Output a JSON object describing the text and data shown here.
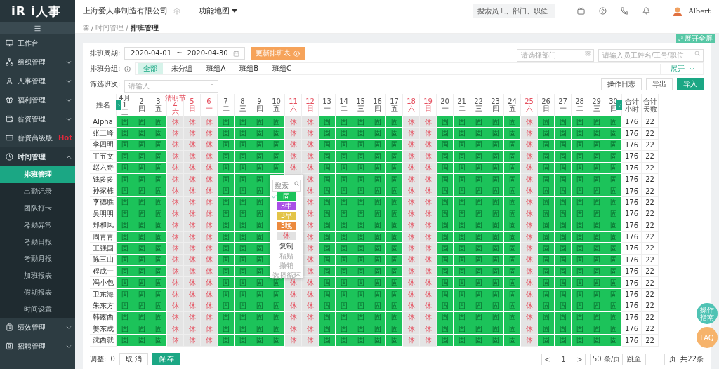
{
  "logo": "iR i人事",
  "sidebar": {
    "items": [
      {
        "label": "工作台"
      },
      {
        "label": "组织管理",
        "expanded": false
      },
      {
        "label": "人事管理",
        "expanded": false
      },
      {
        "label": "福利管理",
        "expanded": false
      },
      {
        "label": "薪资管理",
        "expanded": false
      },
      {
        "label": "薪资高级版",
        "badge": "Hot"
      },
      {
        "label": "时间管理",
        "expanded": true,
        "children": [
          {
            "label": "排班管理",
            "selected": true
          },
          {
            "label": "出勤记录",
            "selected": false
          },
          {
            "label": "团队打卡",
            "selected": false
          },
          {
            "label": "考勤异常",
            "selected": false
          },
          {
            "label": "考勤日报",
            "selected": false
          },
          {
            "label": "考勤月报",
            "selected": false
          },
          {
            "label": "加班报表",
            "selected": false
          },
          {
            "label": "假期报表",
            "selected": false
          },
          {
            "label": "时间设置",
            "selected": false
          }
        ]
      },
      {
        "label": "绩效管理",
        "expanded": false
      },
      {
        "label": "招聘管理",
        "expanded": false
      }
    ]
  },
  "topbar": {
    "company": "上海爱人事制造有限公司",
    "function_map": "功能地图",
    "search": {
      "placeholder": "搜索员工、部门、职位"
    },
    "user": "Albert"
  },
  "breadcrumb": [
    {
      "separator": "/",
      "label": "时间管理"
    },
    {
      "separator": "/",
      "label": "排班管理"
    }
  ],
  "fullscreen_button": "展开全屏",
  "filters": {
    "period_label": "排班周期:",
    "start_date": "2020-04-01",
    "separator": "~",
    "end_date": "2020-04-30",
    "update_button": "更新排班表",
    "department": {
      "placeholder": "请选择部门"
    },
    "employee_search": {
      "placeholder": "请输入员工姓名/工号/职位"
    },
    "group_label": "排班分组:",
    "groups": [
      {
        "label": "全部",
        "selected": true
      },
      {
        "label": "未分组",
        "selected": false
      },
      {
        "label": "班组A",
        "selected": false
      },
      {
        "label": "班组B",
        "selected": false
      },
      {
        "label": "班组C",
        "selected": false
      }
    ],
    "expand": "展开",
    "shift_label": "筛选班次:",
    "shift_select": {
      "placeholder": "请输入"
    },
    "buttons": [
      "操作日志",
      "导出",
      "导入"
    ]
  },
  "table": {
    "name_header": "姓名",
    "hours_header": "合计小时",
    "days_header": "合计天数",
    "days": [
      {
        "month": "4月",
        "date": "1",
        "weekday": "三",
        "rest": false
      },
      {
        "date": "2",
        "weekday": "四",
        "rest": false
      },
      {
        "date": "3",
        "weekday": "五",
        "rest": false
      },
      {
        "holiday": "清明节",
        "date": "4",
        "weekday": "六",
        "rest": true
      },
      {
        "date": "5",
        "weekday": "日",
        "rest": true
      },
      {
        "date": "6",
        "weekday": "一",
        "rest": true
      },
      {
        "date": "7",
        "weekday": "二",
        "rest": false
      },
      {
        "date": "8",
        "weekday": "三",
        "rest": false
      },
      {
        "date": "9",
        "weekday": "四",
        "rest": false
      },
      {
        "date": "10",
        "weekday": "五",
        "rest": false
      },
      {
        "date": "11",
        "weekday": "六",
        "rest": true
      },
      {
        "date": "12",
        "weekday": "日",
        "rest": true
      },
      {
        "date": "13",
        "weekday": "一",
        "rest": false
      },
      {
        "date": "14",
        "weekday": "二",
        "rest": false
      },
      {
        "date": "15",
        "weekday": "三",
        "rest": false
      },
      {
        "date": "16",
        "weekday": "四",
        "rest": false
      },
      {
        "date": "17",
        "weekday": "五",
        "rest": false
      },
      {
        "date": "18",
        "weekday": "六",
        "rest": true
      },
      {
        "date": "19",
        "weekday": "日",
        "rest": true
      },
      {
        "date": "20",
        "weekday": "一",
        "rest": false
      },
      {
        "date": "21",
        "weekday": "二",
        "rest": false
      },
      {
        "date": "22",
        "weekday": "三",
        "rest": false
      },
      {
        "date": "23",
        "weekday": "四",
        "rest": false
      },
      {
        "date": "24",
        "weekday": "五",
        "rest": false
      },
      {
        "date": "25",
        "weekday": "六",
        "rest": true
      },
      {
        "date": "26",
        "weekday": "日",
        "rest": false
      },
      {
        "date": "27",
        "weekday": "一",
        "rest": false
      },
      {
        "date": "28",
        "weekday": "二",
        "rest": false
      },
      {
        "date": "29",
        "weekday": "三",
        "rest": false
      },
      {
        "date": "30",
        "weekday": "四",
        "rest": false
      }
    ],
    "rows": [
      {
        "name": "Alpha",
        "shifts": [
          "固",
          "固",
          "固",
          "休",
          "休",
          "休",
          "固",
          "固",
          "固",
          "固",
          "休",
          "休",
          "固",
          "固",
          "固",
          "固",
          "固",
          "休",
          "休",
          "固",
          "固",
          "固",
          "固",
          "固",
          "休",
          "固",
          "固",
          "固",
          "固",
          "固"
        ],
        "hours": "176",
        "days": "22"
      },
      {
        "name": "张三峰",
        "shifts": [
          "固",
          "固",
          "固",
          "休",
          "休",
          "休",
          "固",
          "固",
          "固",
          "固",
          "休",
          "休",
          "固",
          "固",
          "固",
          "固",
          "固",
          "休",
          "休",
          "固",
          "固",
          "固",
          "固",
          "固",
          "休",
          "固",
          "固",
          "固",
          "固",
          "固"
        ],
        "hours": "176",
        "days": "22"
      },
      {
        "name": "李四明",
        "shifts": [
          "固",
          "固",
          "固",
          "休",
          "休",
          "休",
          "固",
          "固",
          "固",
          "固",
          "休",
          "休",
          "固",
          "固",
          "固",
          "固",
          "固",
          "休",
          "休",
          "固",
          "固",
          "固",
          "固",
          "固",
          "休",
          "固",
          "固",
          "固",
          "固",
          "固"
        ],
        "hours": "176",
        "days": "22"
      },
      {
        "name": "王五文",
        "shifts": [
          "固",
          "固",
          "固",
          "休",
          "休",
          "休",
          "固",
          "固",
          "固",
          "固",
          "休",
          "休",
          "固",
          "固",
          "固",
          "固",
          "固",
          "休",
          "休",
          "固",
          "固",
          "固",
          "固",
          "固",
          "休",
          "固",
          "固",
          "固",
          "固",
          "固"
        ],
        "hours": "176",
        "days": "22"
      },
      {
        "name": "赵六奇",
        "shifts": [
          "固",
          "固",
          "固",
          "休",
          "休",
          "休",
          "固",
          "固",
          "固",
          "固",
          "休",
          "休",
          "固",
          "固",
          "固",
          "固",
          "固",
          "休",
          "休",
          "固",
          "固",
          "固",
          "固",
          "固",
          "休",
          "固",
          "固",
          "固",
          "固",
          "固"
        ],
        "hours": "176",
        "days": "22"
      },
      {
        "name": "钱多多",
        "shifts_before_menu": [
          "固",
          "固",
          "固",
          "休",
          "休",
          "休",
          "固",
          "固",
          "固"
        ],
        "shifts_after_menu": [
          "休",
          "固",
          "固",
          "固",
          "固",
          "固",
          "休",
          "休",
          "固",
          "固",
          "固",
          "固",
          "固",
          "休",
          "固",
          "固",
          "固",
          "固",
          "固"
        ],
        "hours": "176",
        "days": "22"
      },
      {
        "name": "孙家栋",
        "shifts_before_menu": [
          "固",
          "固",
          "固",
          "休",
          "休",
          "休",
          "固",
          "固",
          "固"
        ],
        "shifts_after_menu": [
          "休",
          "固",
          "固",
          "固",
          "固",
          "固",
          "休",
          "休",
          "固",
          "固",
          "固",
          "固",
          "固",
          "休",
          "固",
          "固",
          "固",
          "固",
          "固"
        ],
        "hours": "176",
        "days": "22"
      },
      {
        "name": "李德胜",
        "shifts_before_menu": [
          "固",
          "固",
          "固",
          "休",
          "休",
          "休",
          "固",
          "固",
          "固"
        ],
        "shifts_after_menu": [
          "休",
          "固",
          "固",
          "固",
          "固",
          "固",
          "休",
          "休",
          "固",
          "固",
          "固",
          "固",
          "固",
          "休",
          "固",
          "固",
          "固",
          "固",
          "固"
        ],
        "hours": "176",
        "days": "22"
      },
      {
        "name": "吴明明",
        "shifts_before_menu": [
          "固",
          "固",
          "固",
          "休",
          "休",
          "休",
          "固",
          "固",
          "固"
        ],
        "shifts_after_menu": [
          "休",
          "固",
          "固",
          "固",
          "固",
          "固",
          "休",
          "休",
          "固",
          "固",
          "固",
          "固",
          "固",
          "休",
          "固",
          "固",
          "固",
          "固",
          "固"
        ],
        "hours": "176",
        "days": "22"
      },
      {
        "name": "郑和风",
        "shifts_before_menu": [
          "固",
          "固",
          "固",
          "休",
          "休",
          "休",
          "固",
          "固",
          "固"
        ],
        "shifts_after_menu": [
          "休",
          "固",
          "固",
          "固",
          "固",
          "固",
          "休",
          "休",
          "固",
          "固",
          "固",
          "固",
          "固",
          "休",
          "固",
          "固",
          "固",
          "固",
          "固"
        ],
        "hours": "176",
        "days": "22"
      },
      {
        "name": "周青青",
        "shifts_before_menu": [
          "固",
          "固",
          "固",
          "休",
          "休",
          "休",
          "固",
          "固",
          "固"
        ],
        "shifts_after_menu": [
          "休",
          "固",
          "固",
          "固",
          "固",
          "固",
          "休",
          "休",
          "固",
          "固",
          "固",
          "固",
          "固",
          "休",
          "固",
          "固",
          "固",
          "固",
          "固"
        ],
        "hours": "176",
        "days": "22"
      },
      {
        "name": "王强国",
        "shifts_before_menu": [
          "固",
          "固",
          "固",
          "休",
          "休",
          "休",
          "固",
          "固",
          "固"
        ],
        "shifts_after_menu": [
          "休",
          "固",
          "固",
          "固",
          "固",
          "固",
          "休",
          "休",
          "固",
          "固",
          "固",
          "固",
          "固",
          "休",
          "固",
          "固",
          "固",
          "固",
          "固"
        ],
        "hours": "176",
        "days": "22"
      },
      {
        "name": "陈三山",
        "shifts_before_menu": [
          "固",
          "固",
          "固",
          "休",
          "休",
          "休",
          "固",
          "固",
          "固"
        ],
        "shifts_after_menu": [
          "休",
          "固",
          "固",
          "固",
          "固",
          "固",
          "休",
          "休",
          "固",
          "固",
          "固",
          "固",
          "固",
          "休",
          "固",
          "固",
          "固",
          "固",
          "固"
        ],
        "hours": "176",
        "days": "22"
      },
      {
        "name": "程成一",
        "shifts_before_menu": [
          "固",
          "固",
          "固",
          "休",
          "休",
          "休",
          "固",
          "固",
          "固"
        ],
        "shifts_after_menu": [
          "休",
          "固",
          "固",
          "固",
          "固",
          "固",
          "休",
          "休",
          "固",
          "固",
          "固",
          "固",
          "固",
          "休",
          "固",
          "固",
          "固",
          "固",
          "固"
        ],
        "hours": "176",
        "days": "22"
      },
      {
        "name": "冯小包",
        "shifts": [
          "固",
          "固",
          "固",
          "休",
          "休",
          "休",
          "固",
          "固",
          "固",
          "固",
          "休",
          "休",
          "固",
          "固",
          "固",
          "固",
          "固",
          "休",
          "休",
          "固",
          "固",
          "固",
          "固",
          "固",
          "休",
          "固",
          "固",
          "固",
          "固",
          "固"
        ],
        "hours": "176",
        "days": "22"
      },
      {
        "name": "卫东海",
        "shifts": [
          "固",
          "固",
          "固",
          "休",
          "休",
          "休",
          "固",
          "固",
          "固",
          "固",
          "休",
          "休",
          "固",
          "固",
          "固",
          "固",
          "固",
          "休",
          "休",
          "固",
          "固",
          "固",
          "固",
          "固",
          "休",
          "固",
          "固",
          "固",
          "固",
          "固"
        ],
        "hours": "176",
        "days": "22"
      },
      {
        "name": "朱东方",
        "shifts": [
          "固",
          "固",
          "固",
          "休",
          "休",
          "休",
          "固",
          "固",
          "固",
          "固",
          "休",
          "休",
          "固",
          "固",
          "固",
          "固",
          "固",
          "休",
          "休",
          "固",
          "固",
          "固",
          "固",
          "固",
          "休",
          "固",
          "固",
          "固",
          "固",
          "固"
        ],
        "hours": "176",
        "days": "22"
      },
      {
        "name": "韩露西",
        "shifts": [
          "固",
          "固",
          "固",
          "休",
          "休",
          "休",
          "固",
          "固",
          "固",
          "固",
          "休",
          "休",
          "固",
          "固",
          "固",
          "固",
          "固",
          "休",
          "休",
          "固",
          "固",
          "固",
          "固",
          "固",
          "休",
          "固",
          "固",
          "固",
          "固",
          "固"
        ],
        "hours": "176",
        "days": "22"
      },
      {
        "name": "姜东成",
        "shifts": [
          "固",
          "固",
          "固",
          "休",
          "休",
          "休",
          "固",
          "固",
          "固",
          "固",
          "休",
          "休",
          "固",
          "固",
          "固",
          "固",
          "固",
          "休",
          "休",
          "固",
          "固",
          "固",
          "固",
          "固",
          "休",
          "固",
          "固",
          "固",
          "固",
          "固"
        ],
        "hours": "176",
        "days": "22"
      },
      {
        "name": "沈西就",
        "shifts": [
          "固",
          "固",
          "固",
          "休",
          "休",
          "休",
          "固",
          "固",
          "固",
          "固",
          "休",
          "休",
          "固",
          "固",
          "固",
          "固",
          "固",
          "休",
          "休",
          "固",
          "固",
          "固",
          "固",
          "固",
          "休",
          "固",
          "固",
          "固",
          "固",
          "固"
        ],
        "hours": "176",
        "days": "22"
      }
    ]
  },
  "context_menu": {
    "search": {
      "placeholder": "搜索"
    },
    "options": [
      {
        "label": "固",
        "kind": "work",
        "color": "#1cc35a",
        "checked": true
      },
      {
        "label": "3中",
        "kind": "work",
        "color": "#a94fe6",
        "checked": false
      },
      {
        "label": "3早",
        "kind": "work",
        "color": "#e3c447",
        "checked": false
      },
      {
        "label": "3晚",
        "kind": "work",
        "color": "#ec8a3e",
        "checked": false
      },
      {
        "label": "休",
        "kind": "rest",
        "color": "#e2e2e2",
        "checked": false
      }
    ],
    "actions": [
      {
        "label": "复制",
        "disabled": false
      },
      {
        "label": "粘贴",
        "disabled": true
      },
      {
        "label": "撤销",
        "disabled": true
      },
      {
        "label": "选择循环",
        "disabled": true
      }
    ]
  },
  "footer": {
    "adjust_label": "调整:",
    "adjust_count": "0",
    "cancel": "取 消",
    "save": "保 存",
    "prev": "<",
    "page": "1",
    "next": ">",
    "page_size": "50 条/页",
    "goto": "跳至",
    "page_unit": "页",
    "total": "共22条"
  },
  "float_buttons": [
    {
      "label": "操作指南",
      "color": "#4fc3b4"
    },
    {
      "label": "FAQ",
      "color": "#f6b36b"
    }
  ]
}
